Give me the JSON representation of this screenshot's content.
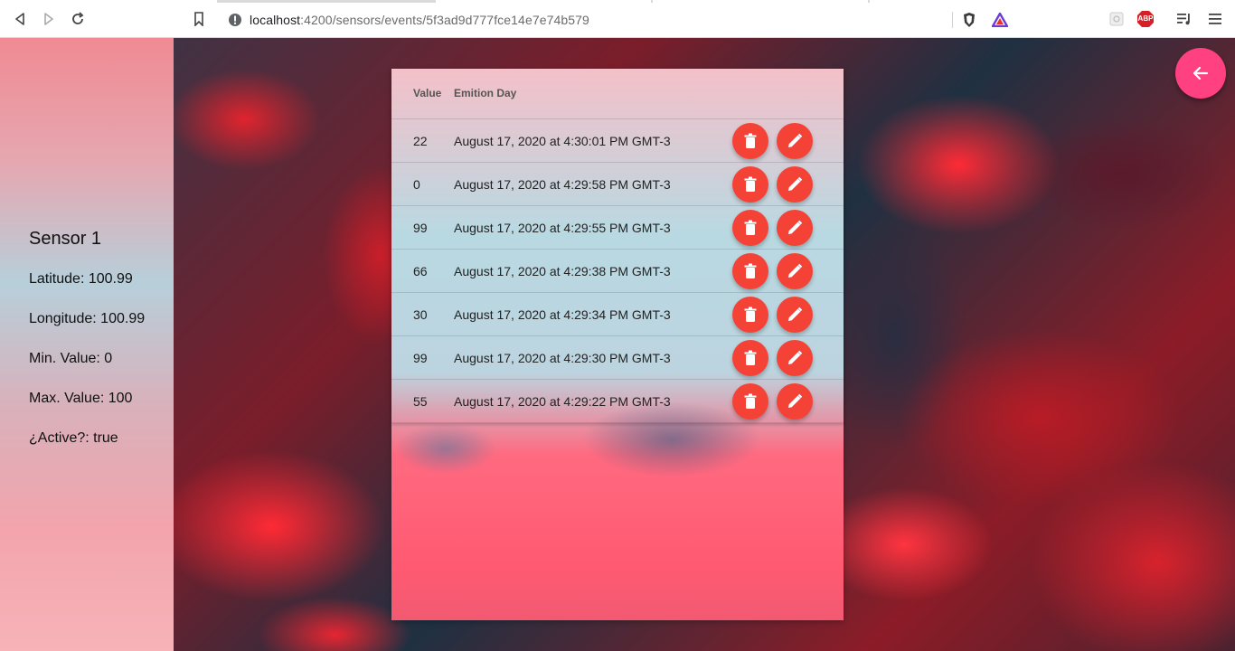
{
  "browser": {
    "url_host": "localhost",
    "url_path": ":4200/sensors/events/5f3ad9d777fce14e7e74b579",
    "icons": [
      "back-icon",
      "forward-icon",
      "reload-icon",
      "bookmark-icon",
      "info-icon",
      "brave-shield-icon",
      "brave-rewards-icon",
      "extension-icon",
      "adblock-icon",
      "playlist-icon",
      "menu-icon"
    ],
    "adblock_label": "ABP"
  },
  "sensor": {
    "title": "Sensor 1",
    "latitude": "Latitude: 100.99",
    "longitude": "Longitude: 100.99",
    "min_value": "Min. Value: 0",
    "max_value": "Max. Value: 100",
    "active": "¿Active?: true"
  },
  "table": {
    "headers": {
      "value": "Value",
      "emition_day": "Emition Day"
    },
    "rows": [
      {
        "value": "22",
        "day": "August 17, 2020 at 4:30:01 PM GMT-3"
      },
      {
        "value": "0",
        "day": "August 17, 2020 at 4:29:58 PM GMT-3"
      },
      {
        "value": "99",
        "day": "August 17, 2020 at 4:29:55 PM GMT-3"
      },
      {
        "value": "66",
        "day": "August 17, 2020 at 4:29:38 PM GMT-3"
      },
      {
        "value": "30",
        "day": "August 17, 2020 at 4:29:34 PM GMT-3"
      },
      {
        "value": "99",
        "day": "August 17, 2020 at 4:29:30 PM GMT-3"
      },
      {
        "value": "55",
        "day": "August 17, 2020 at 4:29:22 PM GMT-3"
      }
    ],
    "row_actions": [
      "delete-icon",
      "edit-icon"
    ]
  },
  "colors": {
    "action_red": "#f44336",
    "back_fab_pink": "#ff4081"
  }
}
